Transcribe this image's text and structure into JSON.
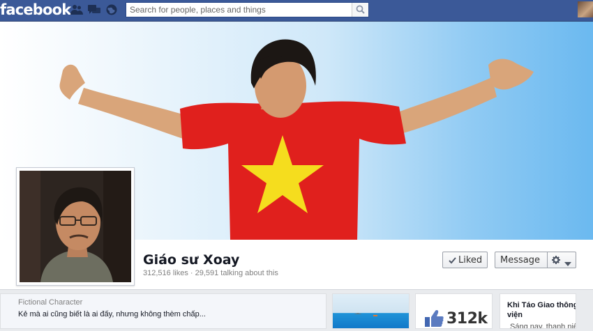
{
  "topbar": {
    "logo": "facebook",
    "search_placeholder": "Search for people, places and things"
  },
  "icons": {
    "friend_requests": "friends-icon",
    "messages": "messages-icon",
    "notifications": "globe-icon",
    "search": "search-icon",
    "settings": "gear-icon",
    "dropdown": "chevron-down-icon",
    "liked": "check-icon",
    "like": "thumbs-up-icon"
  },
  "page": {
    "name": "Giáo sư Xoay",
    "stats": "312,516 likes · 29,591 talking about this",
    "category": "Fictional Character",
    "description": "Kẻ mà ai cũng biết là ai đấy, nhưng không thèm chấp..."
  },
  "actions": {
    "liked_label": "Liked",
    "message_label": "Message"
  },
  "tiles": {
    "likes_count": "312k",
    "app_title_line1": "Khi Táo Giao thông",
    "app_title_line2": "viện",
    "app_snippet": "Sáng nay, thanh niên"
  },
  "colors": {
    "brand_blue": "#3b5998",
    "shirt_red": "#e0201d",
    "star_yellow": "#f5dd1e",
    "sky_blue": "#6bb9f0"
  }
}
